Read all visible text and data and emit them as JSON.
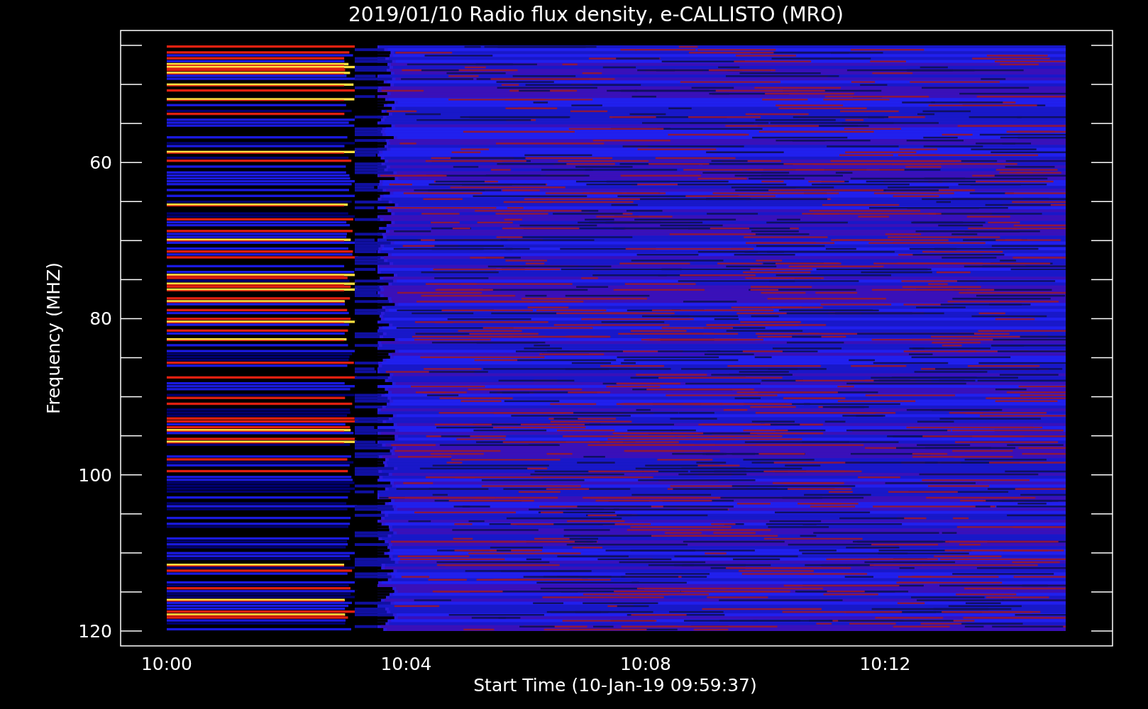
{
  "title": "2019/01/10  Radio flux density, e-CALLISTO (MRO)",
  "y_axis": {
    "label": "Frequency (MHZ)",
    "ticks": [
      "60",
      "80",
      "100",
      "120"
    ]
  },
  "x_axis": {
    "label": "Start Time (10-Jan-19 09:59:37)",
    "ticks": [
      "10:00",
      "10:04",
      "10:08",
      "10:12"
    ]
  }
}
